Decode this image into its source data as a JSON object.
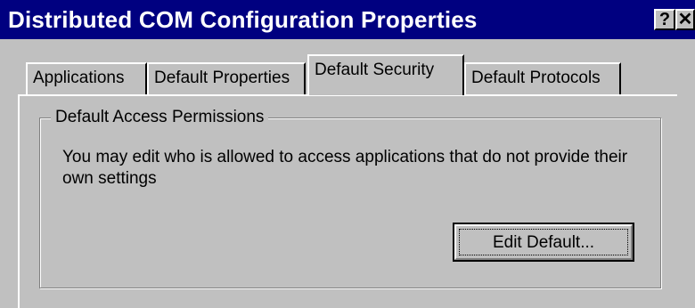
{
  "window": {
    "title": "Distributed COM Configuration Properties",
    "help_label": "?",
    "close_label": "✕",
    "colors": {
      "titlebar": "#000080",
      "face": "#c0c0c0"
    }
  },
  "tabs": [
    {
      "label": "Applications",
      "selected": false
    },
    {
      "label": "Default Properties",
      "selected": false
    },
    {
      "label": "Default Security",
      "selected": true
    },
    {
      "label": "Default Protocols",
      "selected": false
    }
  ],
  "group": {
    "label": "Default Access Permissions",
    "description": "You may edit who is allowed to access applications that do not provide their own settings",
    "button_label": "Edit Default..."
  }
}
